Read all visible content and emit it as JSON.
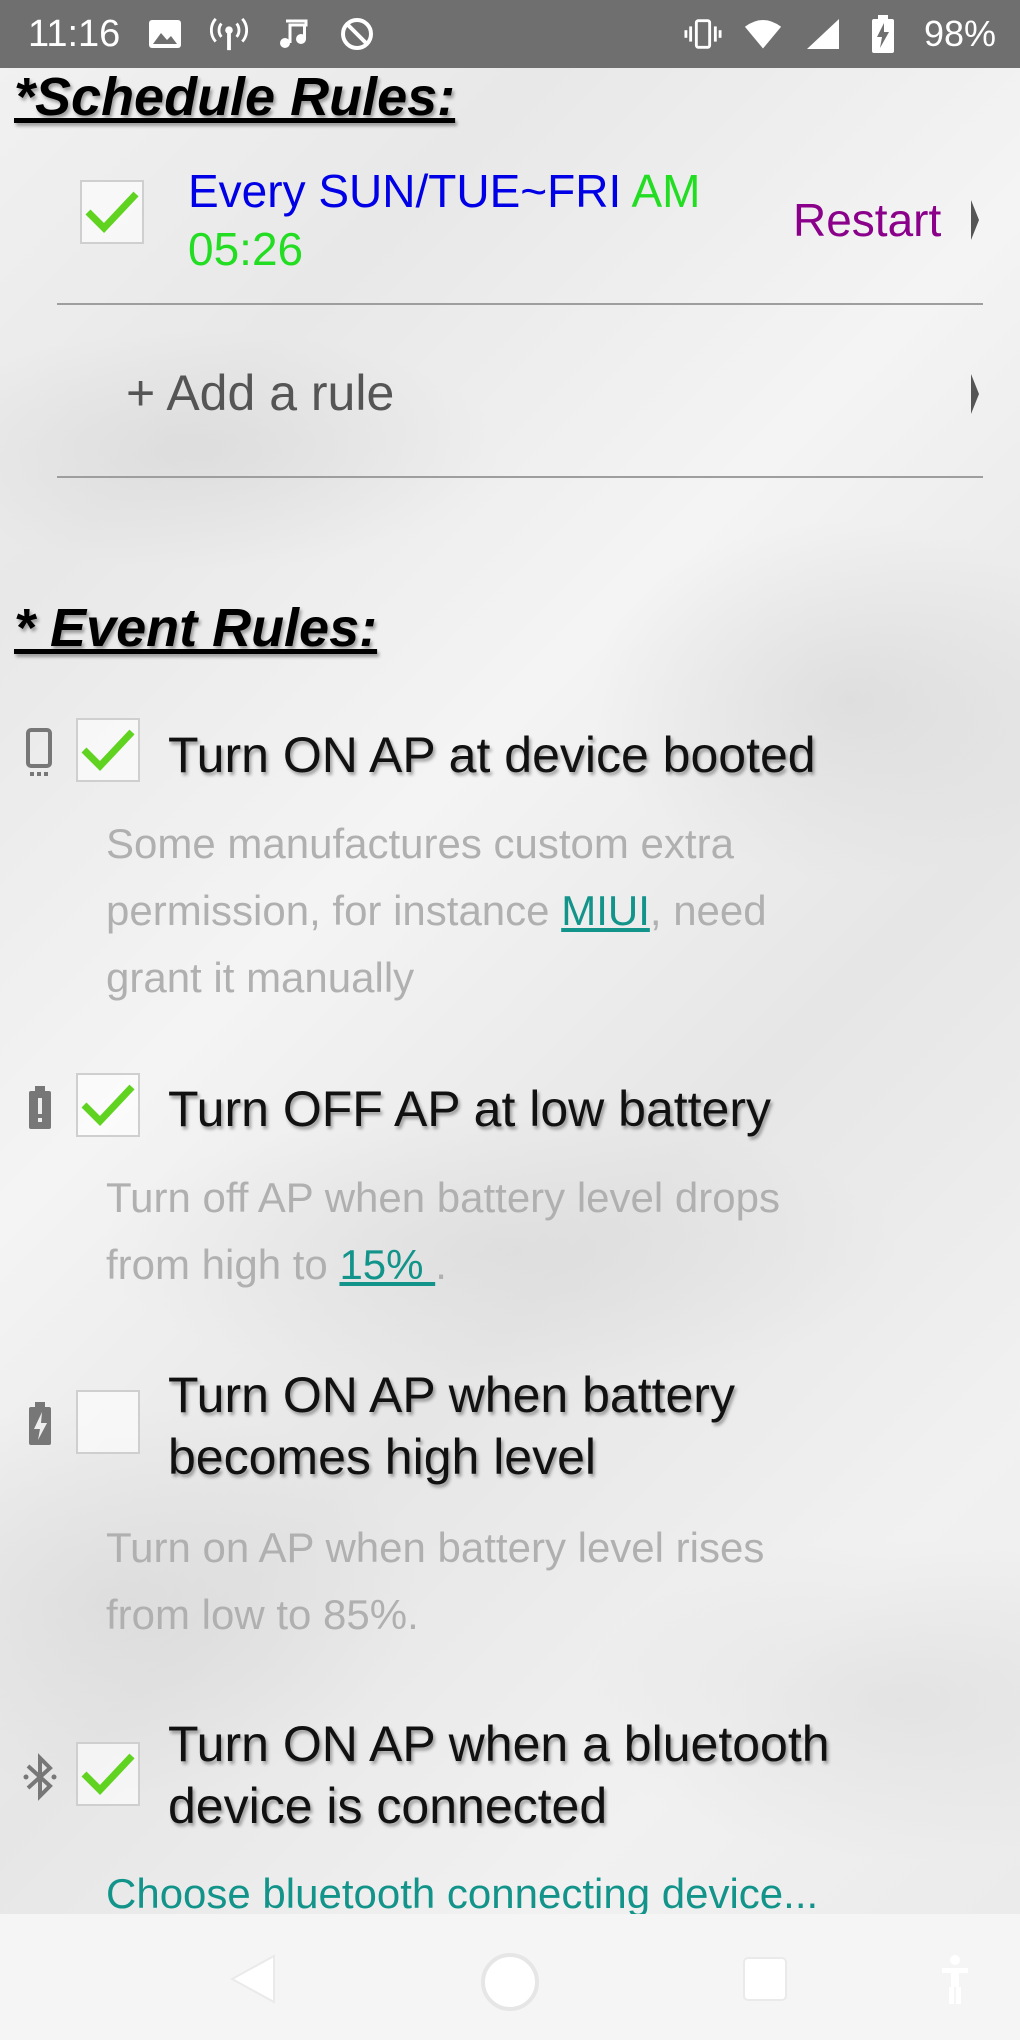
{
  "status_bar": {
    "time": "11:16",
    "battery_pct": "98%"
  },
  "schedule": {
    "title": "*Schedule Rules:",
    "rule": {
      "checked": true,
      "days_text": "Every SUN/TUE~FRI",
      "ampm": "AM",
      "time": "05:26",
      "action": "Restart"
    },
    "add_rule_label": "+ Add a rule"
  },
  "events": {
    "title": "* Event Rules:",
    "items": [
      {
        "icon": "device-icon",
        "checked": true,
        "title": "Turn ON AP at device booted",
        "desc_1": "Some manufactures custom extra",
        "desc_2a": "permission, for instance ",
        "desc_link": "MIUI",
        "desc_2b": ", need",
        "desc_3": "grant it manually"
      },
      {
        "icon": "battery-alert-icon",
        "checked": true,
        "title": "Turn OFF AP at low battery",
        "desc_1": "Turn off AP when battery level drops",
        "desc_2a": "from high to ",
        "desc_link": " 15% ",
        "desc_2b": "."
      },
      {
        "icon": "battery-charging-icon",
        "checked": false,
        "title_1": "Turn ON AP when battery",
        "title_2": "becomes high level",
        "desc_1": "Turn on AP when battery level rises",
        "desc_2": "from low to 85%."
      },
      {
        "icon": "bluetooth-icon",
        "checked": true,
        "title_1": "Turn ON AP when a bluetooth",
        "title_2": "device is connected",
        "link": "Choose bluetooth connecting device..."
      }
    ]
  },
  "colors": {
    "accent_teal": "#12948a",
    "check_green": "#5fd31f",
    "schedule_blue": "#0000e6",
    "restart_purple": "#8b008b"
  }
}
